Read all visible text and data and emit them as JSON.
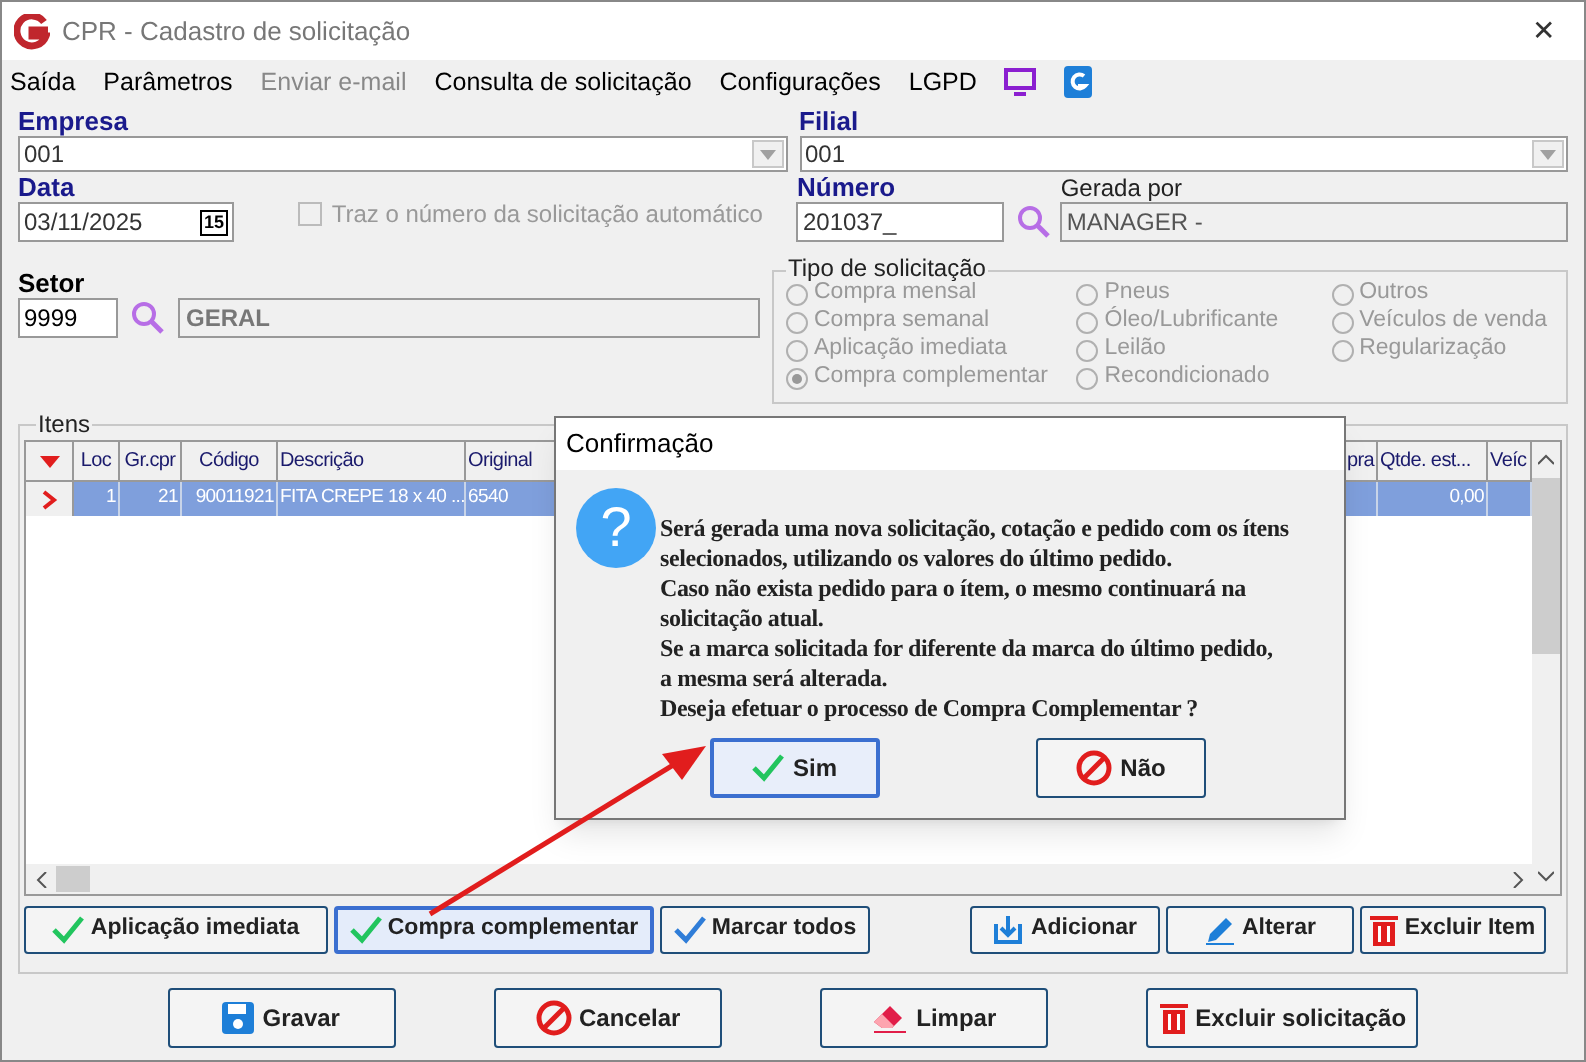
{
  "window": {
    "title": "CPR - Cadastro de solicitação",
    "close": "✕"
  },
  "menu": [
    {
      "label": "Saída",
      "disabled": false
    },
    {
      "label": "Parâmetros",
      "disabled": false
    },
    {
      "label": "Enviar e-mail",
      "disabled": true
    },
    {
      "label": "Consulta de solicitação",
      "disabled": false
    },
    {
      "label": "Configurações",
      "disabled": false
    },
    {
      "label": "LGPD",
      "disabled": false
    }
  ],
  "empresa": {
    "label": "Empresa",
    "value": "001"
  },
  "filial": {
    "label": "Filial",
    "value": "001"
  },
  "data": {
    "label": "Data",
    "value": "03/11/2025",
    "calendar": "15"
  },
  "auto_number": {
    "label": "Traz o número da solicitação automático",
    "checked": false,
    "disabled": true
  },
  "numero": {
    "label": "Número",
    "value": "201037_"
  },
  "gerada_por": {
    "label": "Gerada por",
    "value": "MANAGER -"
  },
  "setor": {
    "label": "Setor",
    "code": "9999",
    "name": "GERAL"
  },
  "tipo": {
    "title": "Tipo de solicitação",
    "columns": [
      [
        {
          "label": "Compra mensal",
          "selected": false
        },
        {
          "label": "Compra semanal",
          "selected": false
        },
        {
          "label": "Aplicação imediata",
          "selected": false
        },
        {
          "label": "Compra complementar",
          "selected": true
        }
      ],
      [
        {
          "label": "Pneus",
          "selected": false
        },
        {
          "label": "Óleo/Lubrificante",
          "selected": false
        },
        {
          "label": "Leilão",
          "selected": false
        },
        {
          "label": "Recondicionado",
          "selected": false
        }
      ],
      [
        {
          "label": "Outros",
          "selected": false
        },
        {
          "label": "Veículos de venda",
          "selected": false
        },
        {
          "label": "Regularização",
          "selected": false
        }
      ]
    ]
  },
  "itens": {
    "title": "Itens",
    "columns": [
      "Loc",
      "Gr.cpr",
      "Código",
      "Descrição",
      "Original",
      "pra",
      "Qtde. est...",
      "Veíc"
    ],
    "rows": [
      {
        "selected": true,
        "cells": [
          "1",
          "21",
          "90011921",
          "FITA CREPE 18 x 40 ...",
          "6540",
          null,
          "0,00",
          null
        ]
      }
    ],
    "buttons": [
      {
        "label": "Aplicação imediata",
        "kind": "check-green",
        "focused": false
      },
      {
        "label": "Compra complementar",
        "kind": "check-green",
        "focused": true
      },
      {
        "label": "Marcar todos",
        "kind": "check-blue",
        "focused": false
      },
      {
        "label": "Adicionar",
        "kind": "add",
        "focused": false
      },
      {
        "label": "Alterar",
        "kind": "edit",
        "focused": false
      },
      {
        "label": "Excluir Item",
        "kind": "delete",
        "focused": false
      }
    ]
  },
  "footer_buttons": [
    {
      "label": "Gravar",
      "kind": "save"
    },
    {
      "label": "Cancelar",
      "kind": "cancel"
    },
    {
      "label": "Limpar",
      "kind": "eraser"
    },
    {
      "label": "Excluir solicitação",
      "kind": "delete"
    }
  ],
  "dialog": {
    "title": "Confirmação",
    "icon_glyph": "?",
    "message_lines": [
      "Será gerada uma nova solicitação, cotação e pedido com os ítens",
      "selecionados, utilizando os valores do último pedido.",
      "Caso não exista pedido para o ítem, o mesmo continuará na",
      "solicitação atual.",
      "Se a marca solicitada for diferente da marca do último pedido,",
      "a mesma será alterada.",
      "Deseja efetuar o processo de Compra Complementar ?"
    ],
    "buttons": [
      {
        "label": "Sim",
        "kind": "check-green",
        "focused": true
      },
      {
        "label": "Não",
        "kind": "cancel",
        "focused": false
      }
    ]
  }
}
